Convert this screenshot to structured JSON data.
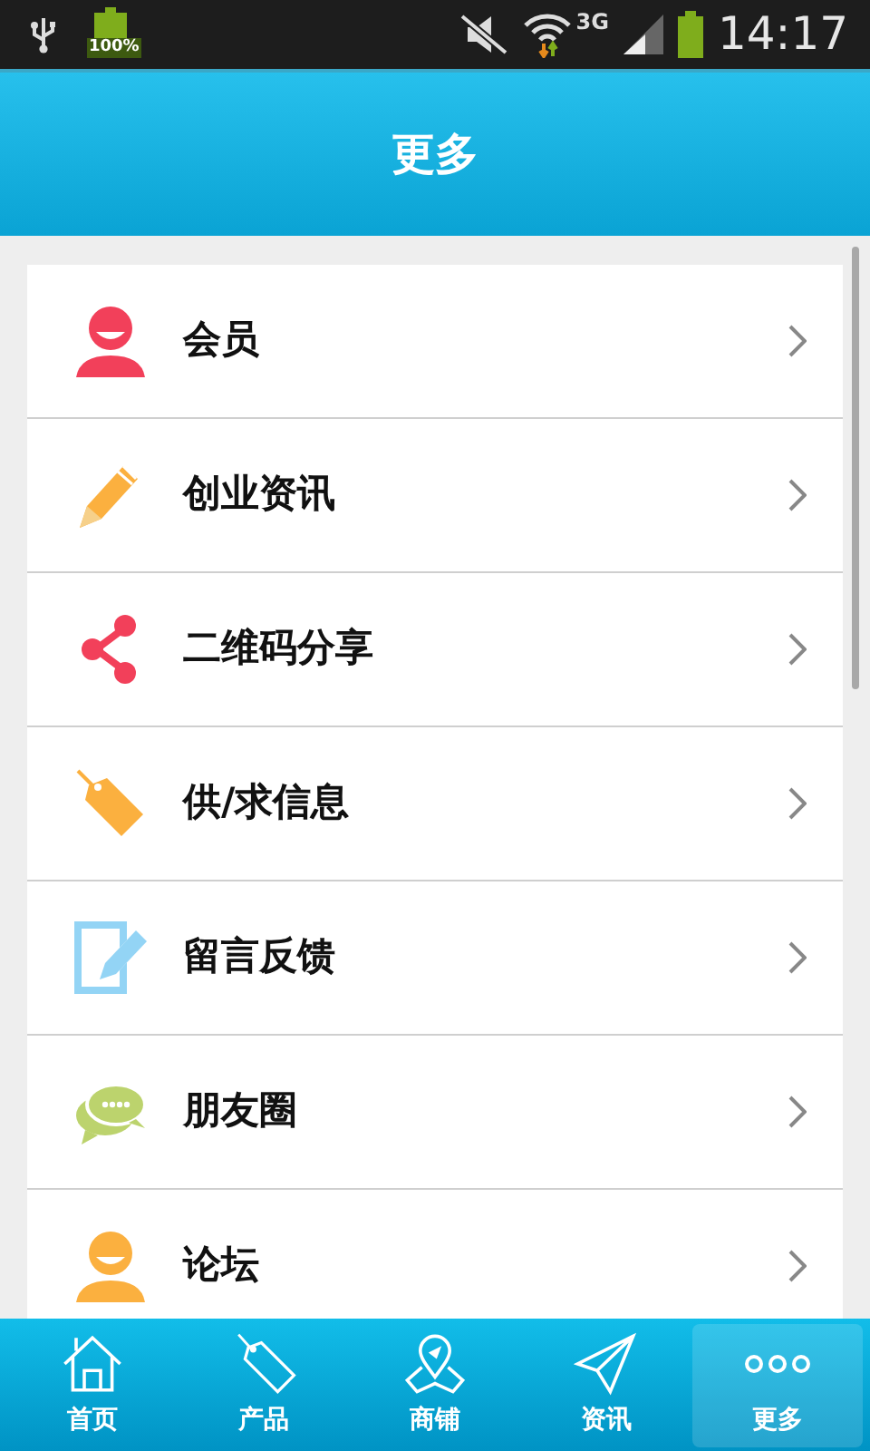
{
  "status_bar": {
    "battery_text": "100%",
    "network": "3G",
    "time": "14:17"
  },
  "header": {
    "title": "更多"
  },
  "menu": [
    {
      "label": "会员",
      "kind": "person",
      "color": "#f2405a"
    },
    {
      "label": "创业资讯",
      "kind": "pencil",
      "color": "#fbb03f"
    },
    {
      "label": "二维码分享",
      "kind": "share",
      "color": "#f2405a"
    },
    {
      "label": "供/求信息",
      "kind": "tag",
      "color": "#fbb03f"
    },
    {
      "label": "留言反馈",
      "kind": "edit",
      "color": "#93d4f5"
    },
    {
      "label": "朋友圈",
      "kind": "chat",
      "color": "#bcd36d"
    },
    {
      "label": "论坛",
      "kind": "person",
      "color": "#fbb03f"
    }
  ],
  "tab_bar": [
    {
      "label": "首页",
      "kind": "home",
      "selected": false
    },
    {
      "label": "产品",
      "kind": "tag",
      "selected": false
    },
    {
      "label": "商铺",
      "kind": "map",
      "selected": false
    },
    {
      "label": "资讯",
      "kind": "send",
      "selected": false
    },
    {
      "label": "更多",
      "kind": "more",
      "selected": true
    }
  ]
}
